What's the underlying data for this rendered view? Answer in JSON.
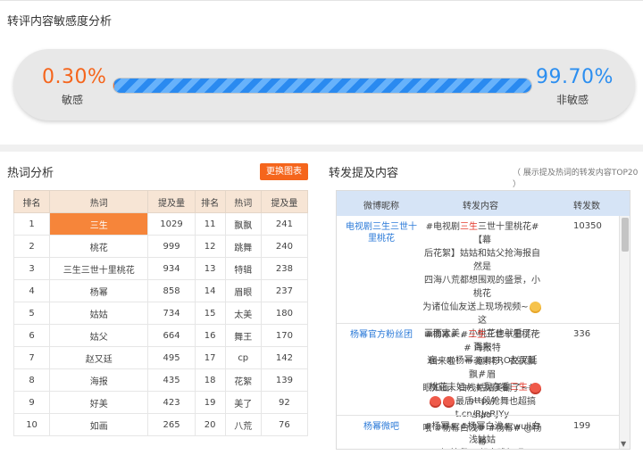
{
  "sensitivity": {
    "title": "转评内容敏感度分析",
    "sensitive_pct": "0.30%",
    "sensitive_label": "敏感",
    "nonsensitive_pct": "99.70%",
    "nonsensitive_label": "非敏感",
    "sensitive_fraction": 0.003,
    "colors": {
      "sensitive": "#f5651c",
      "nonsensitive": "#2b8ef0"
    }
  },
  "hot_words": {
    "title": "热词分析",
    "switch_label": "更换图表",
    "headers": [
      "排名",
      "热词",
      "提及量",
      "排名",
      "热词",
      "提及量"
    ],
    "rows": [
      [
        "1",
        "三生",
        "1029",
        "11",
        "飘飘",
        "241"
      ],
      [
        "2",
        "桃花",
        "999",
        "12",
        "跳舞",
        "240"
      ],
      [
        "3",
        "三生三世十里桃花",
        "934",
        "13",
        "特辑",
        "238"
      ],
      [
        "4",
        "杨幂",
        "858",
        "14",
        "眉眼",
        "237"
      ],
      [
        "5",
        "姑姑",
        "734",
        "15",
        "太美",
        "180"
      ],
      [
        "6",
        "姑父",
        "664",
        "16",
        "舞王",
        "170"
      ],
      [
        "7",
        "赵又廷",
        "495",
        "17",
        "cp",
        "142"
      ],
      [
        "8",
        "海报",
        "435",
        "18",
        "花絮",
        "139"
      ],
      [
        "9",
        "好美",
        "423",
        "19",
        "美了",
        "92"
      ],
      [
        "10",
        "如画",
        "265",
        "20",
        "八荒",
        "76"
      ]
    ],
    "highlight_color": "#f6853a"
  },
  "forwards": {
    "title": "转发提及内容",
    "subtitle": "（ 展示提及热词的转发内容TOP20 ）",
    "headers": {
      "nick": "微博昵称",
      "content": "转发内容",
      "count": "转发数"
    },
    "rows": [
      {
        "nick": "电视剧三生三世十里桃花",
        "count": "10350",
        "lines": [
          "#电视剧三生三世十里桃花#【幕",
          "后花絮】姑姑和姑父抢海报自然是",
          "四海八荒都想围观的盛景，小桃花",
          "为诸位仙友送上现场视频~",
          "画面太美，小桃花也就看了一百来",
          "遍~ @杨幂 @HERO赵又廷 #",
          "桃花夫妇# #我在看三生# http://",
          "t.cn/RJnRJYy"
        ]
      },
      {
        "nick": "杨幂官方粉丝团",
        "count": "336",
        "lines": [
          "#杨幂# #三生三世十里桃花# 海报特",
          "辑来啦！一袭素衫，衣袂飘飘，眉",
          "眼如画，白浅姑姑美翻了~",
          "最后一段抢舞也超搞siao",
          "哦 #杨幂白浅# #杨幂# @杨",
          "幂"
        ]
      },
      {
        "nick": "杨幂微吧",
        "count": "199",
        "lines": [
          "#杨幂# #杨幂白浅# wuli白浅姑姑",
          "好美啊 一起来跳舞吧",
          ""
        ]
      }
    ]
  }
}
